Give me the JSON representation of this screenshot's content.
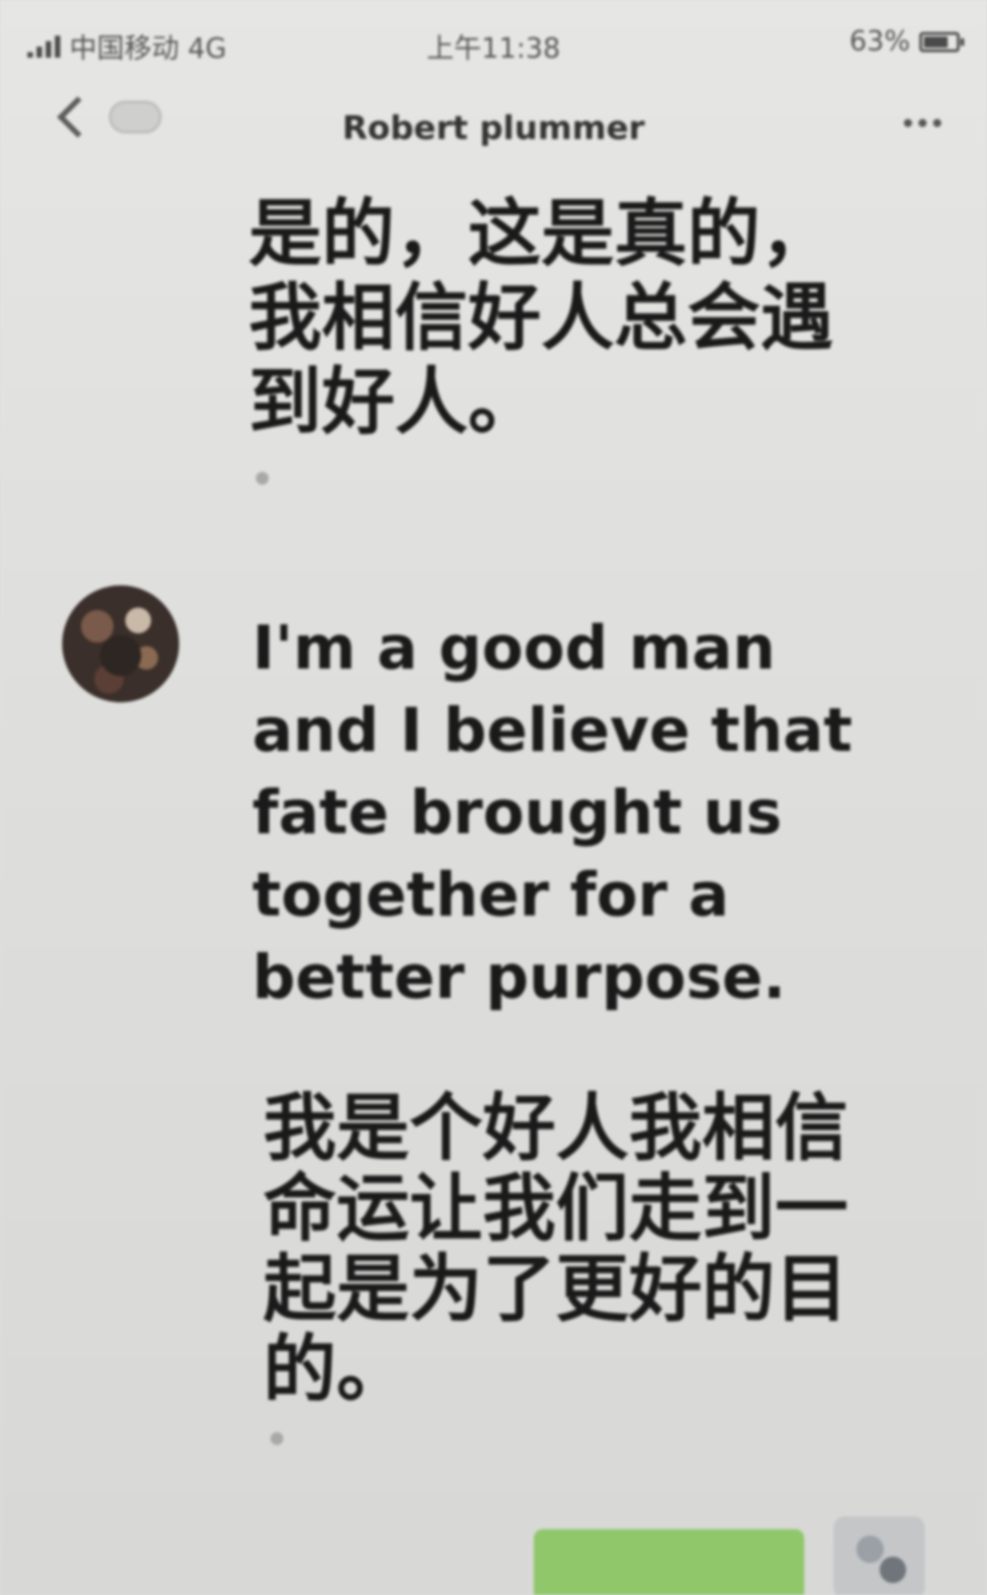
{
  "status_bar": {
    "carrier": "中国移动 4G",
    "time": "上午11:38",
    "battery": "63%"
  },
  "nav": {
    "title": "Robert plummer"
  },
  "messages": {
    "top_text": "是的，这是真的，我相信好人总会遇到好人。",
    "english_text": "I'm a good man and I believe that fate brought us together for a better purpose.",
    "chinese_text": "我是个好人我相信命运让我们走到一起是为了更好的目的。"
  },
  "icons": {
    "back": "chevron-left-icon",
    "chat_list": "chat-list-icon",
    "more": "more-dots-icon",
    "signal": "signal-icon",
    "battery": "battery-icon",
    "translate": "translate-dot-icon"
  },
  "colors": {
    "background": "#dfdfdd",
    "text": "#1a1a1a",
    "outgoing_bubble": "#8fc76a"
  }
}
